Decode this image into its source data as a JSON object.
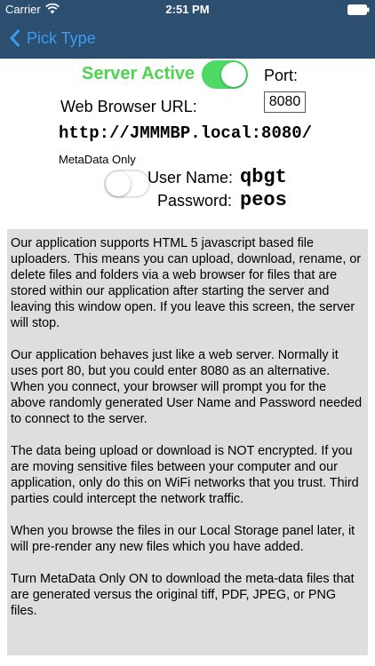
{
  "status_bar": {
    "carrier": "Carrier",
    "time": "2:51 PM",
    "icons": [
      "wifi-icon",
      "battery-icon"
    ]
  },
  "nav": {
    "back_label": "Pick Type",
    "back_icon": "chevron-left-icon"
  },
  "server": {
    "label": "Server Active",
    "active": true,
    "port_label": "Port:",
    "port_value": "8080",
    "url_label": "Web Browser URL:",
    "url": "http://JMMMBP.local:8080/"
  },
  "metadata": {
    "label": "MetaData Only",
    "on": false
  },
  "credentials": {
    "username_label": "User Name:",
    "username": "qbgt",
    "password_label": "Password:",
    "password": "peos"
  },
  "info": {
    "paragraphs": [
      "Our application supports HTML 5 javascript based file uploaders. This means you can upload, download, rename, or delete files and folders via a web browser for files that are stored within our application after starting the server and leaving this window open.  If you leave this screen, the server will stop.",
      "Our application behaves just like a web server. Normally it uses port 80, but you could enter 8080 as an alternative. When you connect, your browser will prompt you for the above randomly generated User Name and Password needed to connect to the server.",
      "The data being upload or download is NOT encrypted. If you are moving sensitive files between your computer and our application, only do this on WiFi networks that you trust. Third parties could intercept the network traffic.",
      "When you browse the files in our Local Storage panel later, it will pre-render any new files which you have added.",
      "Turn MetaData Only ON to download the meta-data files that are generated versus the original tiff, PDF, JPEG, or PNG files."
    ]
  },
  "colors": {
    "nav_bar": "#2c4f70",
    "accent_blue": "#3a9bf0",
    "server_active_green": "#4cd44c",
    "toggle_on": "#4cd964",
    "panel_gray": "#dedede"
  }
}
